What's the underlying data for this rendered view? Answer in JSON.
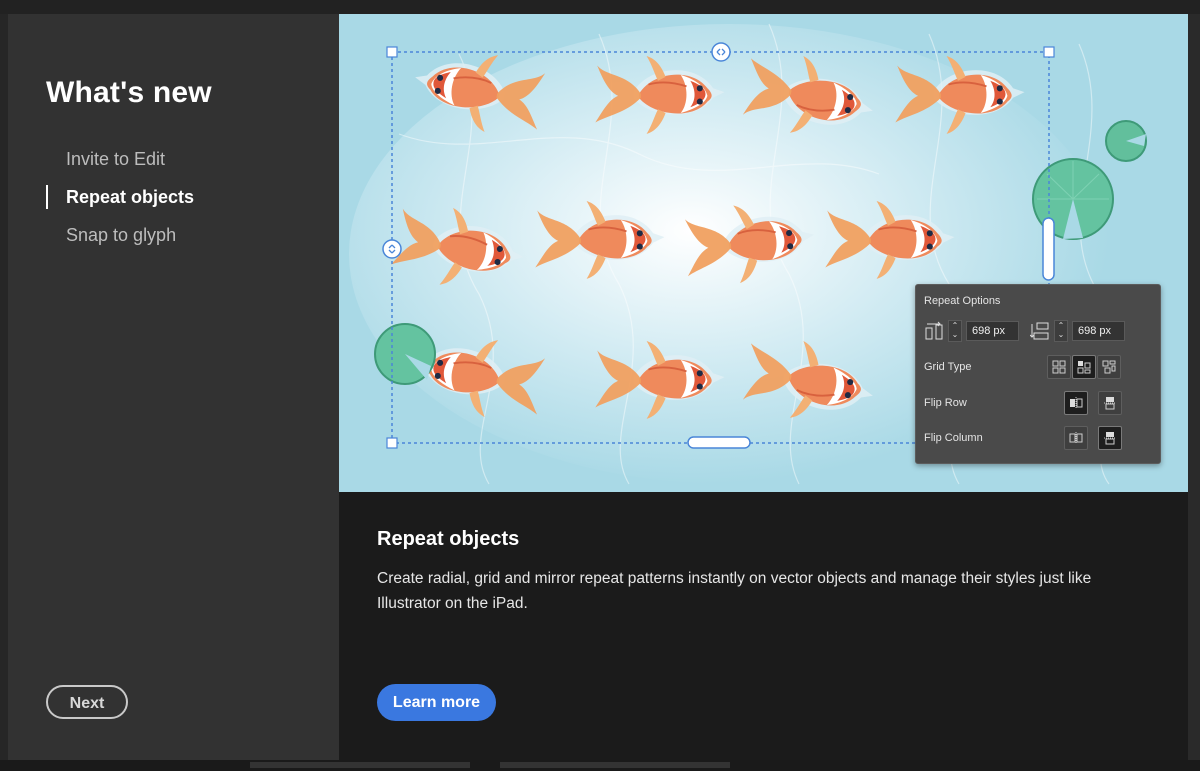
{
  "sidebar": {
    "title": "What's new",
    "items": [
      {
        "label": "Invite to Edit",
        "active": false
      },
      {
        "label": "Repeat objects",
        "active": true
      },
      {
        "label": "Snap to glyph",
        "active": false
      }
    ],
    "next_label": "Next"
  },
  "feature": {
    "title": "Repeat objects",
    "description": "Create radial, grid and mirror repeat patterns instantly on vector objects and manage their styles just like Illustrator on the iPad.",
    "learn_more_label": "Learn more"
  },
  "repeat_options": {
    "title": "Repeat Options",
    "horizontal_spacing": "698 px",
    "vertical_spacing": "698 px",
    "grid_type_label": "Grid Type",
    "flip_row_label": "Flip Row",
    "flip_column_label": "Flip Column",
    "grid_type_selected": 1,
    "flip_row_selected": 0,
    "flip_column_selected": 1
  },
  "colors": {
    "accent": "#3a78e0",
    "sidebar_bg": "#323232",
    "content_bg": "#1b1b1b",
    "illustration_bg": "#a9d9e6",
    "koi": "#e8744a",
    "lily_pad": "#5fbf9a",
    "selection": "#4a86d8"
  },
  "icons": [
    "horizontal-spacing-icon",
    "vertical-spacing-icon",
    "grid-type-icon",
    "flip-row-icon",
    "flip-column-icon",
    "chevron-stepper-icon",
    "resize-handle-icon"
  ]
}
